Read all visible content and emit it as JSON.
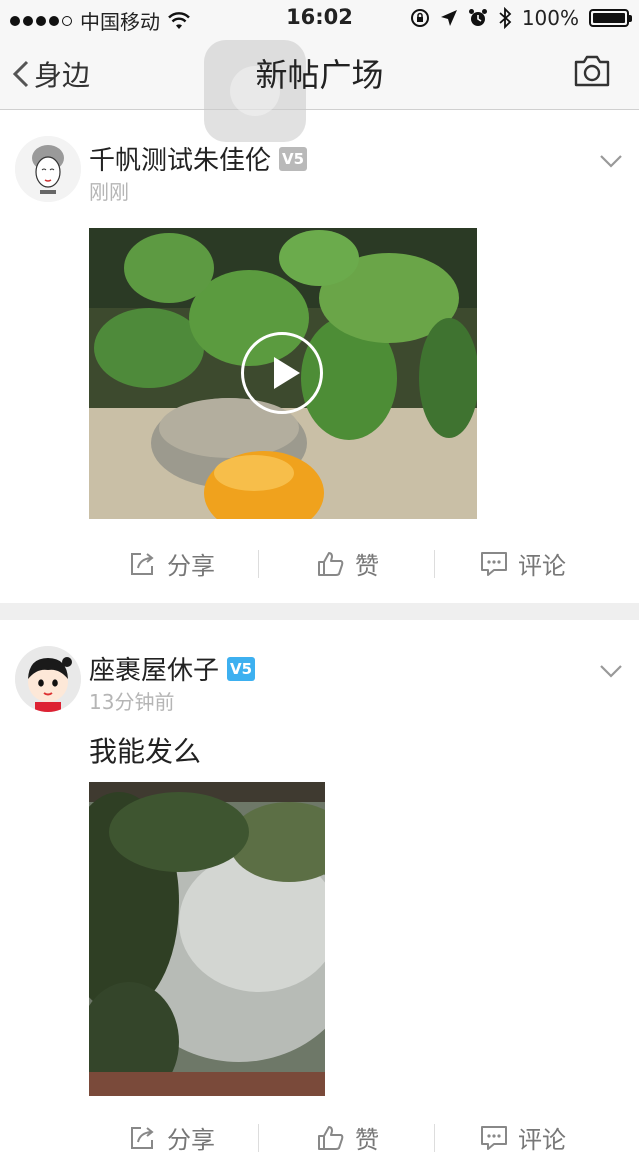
{
  "status_bar": {
    "carrier": "中国移动",
    "time": "16:02",
    "battery": "100%"
  },
  "nav": {
    "back_label": "身边",
    "title": "新帖广场"
  },
  "posts": [
    {
      "username": "千帆测试朱佳伦",
      "badge": "V5",
      "badge_color": "#b9b9b9",
      "time": "刚刚",
      "text": "",
      "media_type": "video",
      "actions": {
        "share": "分享",
        "like": "赞",
        "comment": "评论"
      }
    },
    {
      "username": "座裹屋休子",
      "badge": "V5",
      "badge_color": "#3db0f0",
      "time": "13分钟前",
      "text": "我能发么",
      "media_type": "image",
      "actions": {
        "share": "分享",
        "like": "赞",
        "comment": "评论"
      }
    }
  ],
  "colors": {
    "accent_blue": "#3db0f0",
    "meta_gray": "#b5b5b5",
    "separator": "#efefef"
  }
}
